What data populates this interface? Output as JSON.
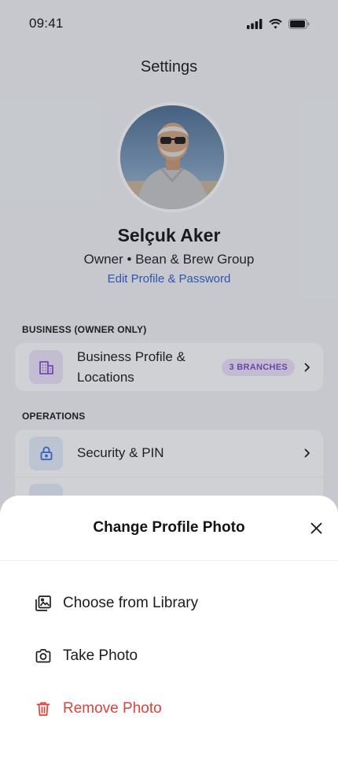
{
  "status_bar": {
    "time": "09:41"
  },
  "header": {
    "title": "Settings"
  },
  "profile": {
    "name": "Selçuk Aker",
    "role": "Owner • Bean & Brew Group",
    "edit_link": "Edit Profile & Password"
  },
  "sections": {
    "business": {
      "header": "BUSINESS (OWNER ONLY)",
      "items": [
        {
          "label": "Business Profile & Locations",
          "label_line1": "Business Profile &",
          "label_line2": "Locations",
          "badge": "3 BRANCHES",
          "icon": "building-icon"
        }
      ]
    },
    "operations": {
      "header": "OPERATIONS",
      "items": [
        {
          "label": "Security & PIN",
          "icon": "lock-icon"
        }
      ]
    }
  },
  "sheet": {
    "title": "Change Profile Photo",
    "options": [
      {
        "label": "Choose from Library",
        "icon": "photo-library-icon"
      },
      {
        "label": "Take Photo",
        "icon": "camera-icon"
      },
      {
        "label": "Remove Photo",
        "icon": "trash-icon"
      }
    ]
  },
  "colors": {
    "accent_blue": "#2f62d6",
    "badge_purple": "#7c4dc8",
    "danger_red": "#e0413a"
  }
}
